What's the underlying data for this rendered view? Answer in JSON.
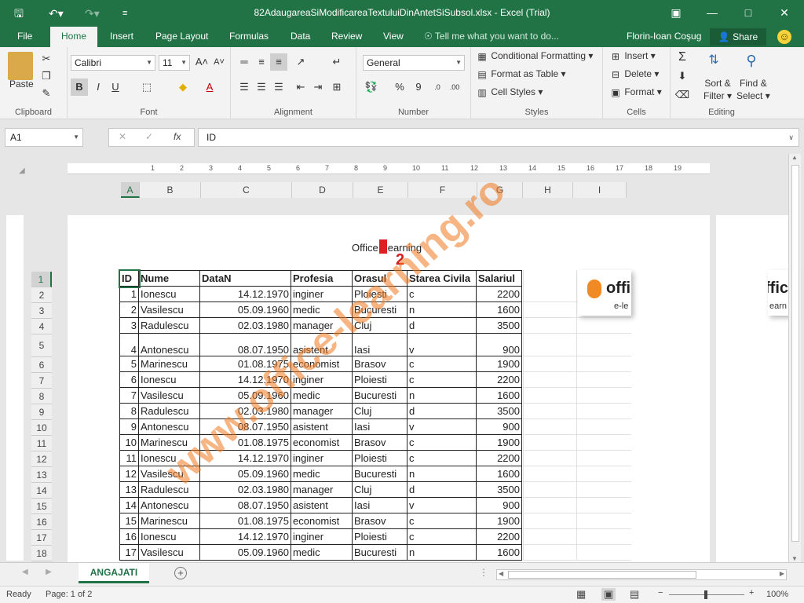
{
  "titlebar": {
    "title": "82AdaugareaSiModificareaTextuluiDinAntetSiSubsol.xlsx - Excel (Trial)",
    "save_icon": "save-icon",
    "undo_icon": "undo-icon",
    "redo_icon": "redo-icon"
  },
  "tabs": {
    "file": "File",
    "home": "Home",
    "insert": "Insert",
    "page_layout": "Page Layout",
    "formulas": "Formulas",
    "data": "Data",
    "review": "Review",
    "view": "View",
    "tell_me": "Tell me what you want to do...",
    "user": "Florin-Ioan Coşug",
    "share": "Share"
  },
  "ribbon": {
    "clipboard": {
      "label": "Clipboard",
      "paste": "Paste"
    },
    "font": {
      "label": "Font",
      "font_name": "Calibri",
      "font_size": "11",
      "bold": "B",
      "italic": "I",
      "underline": "U"
    },
    "alignment": {
      "label": "Alignment"
    },
    "number": {
      "label": "Number",
      "format": "General",
      "percent": "%",
      "comma": "9"
    },
    "styles": {
      "label": "Styles",
      "conditional": "Conditional Formatting",
      "format_table": "Format as Table",
      "cell_styles": "Cell Styles"
    },
    "cells": {
      "label": "Cells",
      "insert": "Insert",
      "delete": "Delete",
      "format": "Format"
    },
    "editing": {
      "label": "Editing",
      "sort": "Sort &",
      "filter": "Filter",
      "find": "Find &",
      "select": "Select"
    }
  },
  "formula_bar": {
    "name_box": "A1",
    "fx": "fx",
    "value": "ID"
  },
  "ruler": {
    "ticks": [
      "1",
      "2",
      "3",
      "4",
      "5",
      "6",
      "7",
      "8",
      "9",
      "10",
      "11",
      "12",
      "13",
      "14",
      "15",
      "16",
      "17",
      "18",
      "19"
    ]
  },
  "columns": [
    "A",
    "B",
    "C",
    "D",
    "E",
    "F",
    "G",
    "H",
    "I"
  ],
  "page": {
    "header_left": "Office",
    "header_right": "earning",
    "badge": "2"
  },
  "table": {
    "headers": [
      "ID",
      "Nume",
      "DataN",
      "Profesia",
      "Orasul",
      "Starea Civila",
      "Salariul"
    ],
    "rows": [
      [
        "1",
        "Ionescu",
        "14.12.1970",
        "inginer",
        "Ploiesti",
        "c",
        "2200"
      ],
      [
        "2",
        "Vasilescu",
        "05.09.1960",
        "medic",
        "Bucuresti",
        "n",
        "1600"
      ],
      [
        "3",
        "Radulescu",
        "02.03.1980",
        "manager",
        "Cluj",
        "d",
        "3500"
      ],
      [
        "4",
        "Antonescu",
        "08.07.1950",
        "asistent",
        "Iasi",
        "v",
        "900"
      ],
      [
        "5",
        "Marinescu",
        "01.08.1975",
        "economist",
        "Brasov",
        "c",
        "1900"
      ],
      [
        "6",
        "Ionescu",
        "14.12.1970",
        "inginer",
        "Ploiesti",
        "c",
        "2200"
      ],
      [
        "7",
        "Vasilescu",
        "05.09.1960",
        "medic",
        "Bucuresti",
        "n",
        "1600"
      ],
      [
        "8",
        "Radulescu",
        "02.03.1980",
        "manager",
        "Cluj",
        "d",
        "3500"
      ],
      [
        "9",
        "Antonescu",
        "08.07.1950",
        "asistent",
        "Iasi",
        "v",
        "900"
      ],
      [
        "10",
        "Marinescu",
        "01.08.1975",
        "economist",
        "Brasov",
        "c",
        "1900"
      ],
      [
        "11",
        "Ionescu",
        "14.12.1970",
        "inginer",
        "Ploiesti",
        "c",
        "2200"
      ],
      [
        "12",
        "Vasilescu",
        "05.09.1960",
        "medic",
        "Bucuresti",
        "n",
        "1600"
      ],
      [
        "13",
        "Radulescu",
        "02.03.1980",
        "manager",
        "Cluj",
        "d",
        "3500"
      ],
      [
        "14",
        "Antonescu",
        "08.07.1950",
        "asistent",
        "Iasi",
        "v",
        "900"
      ],
      [
        "15",
        "Marinescu",
        "01.08.1975",
        "economist",
        "Brasov",
        "c",
        "1900"
      ],
      [
        "16",
        "Ionescu",
        "14.12.1970",
        "inginer",
        "Ploiesti",
        "c",
        "2200"
      ],
      [
        "17",
        "Vasilescu",
        "05.09.1960",
        "medic",
        "Bucuresti",
        "n",
        "1600"
      ]
    ]
  },
  "row_numbers": [
    "1",
    "2",
    "3",
    "4",
    "5",
    "6",
    "7",
    "8",
    "9",
    "10",
    "11",
    "12",
    "13",
    "14",
    "15",
    "16",
    "17",
    "18"
  ],
  "logo": {
    "brand": "offi",
    "sub": "e-le",
    "brand2": "ffic",
    "sub2": "earn"
  },
  "watermark": "www.office-learning.ro",
  "sheet_tab": "ANGAJATI",
  "status": {
    "ready": "Ready",
    "page": "Page: 1 of 2",
    "zoom": "100%"
  },
  "colors": {
    "accent": "#217346",
    "header_marker": "#e02020",
    "watermark": "#f0781e"
  }
}
